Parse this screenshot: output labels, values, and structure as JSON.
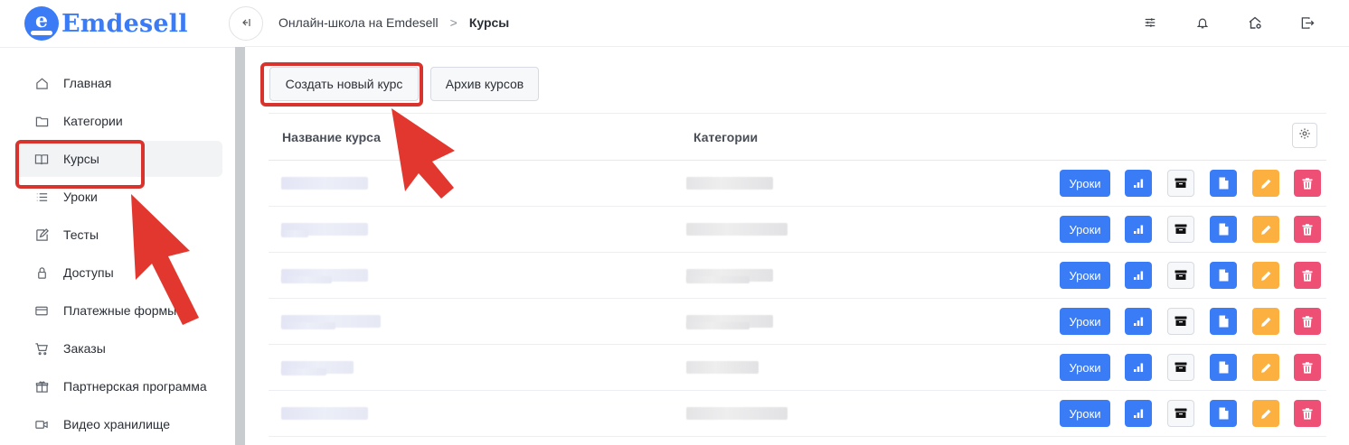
{
  "app": {
    "logo_text": "Emdesell",
    "logo_letter": "e",
    "brand_color": "#3b7cf6"
  },
  "sidebar": {
    "items": [
      {
        "label": "Главная",
        "icon": "home-icon",
        "active": false
      },
      {
        "label": "Категории",
        "icon": "folder-icon",
        "active": false
      },
      {
        "label": "Курсы",
        "icon": "book-icon",
        "active": true
      },
      {
        "label": "Уроки",
        "icon": "list-icon",
        "active": false
      },
      {
        "label": "Тесты",
        "icon": "edit-icon",
        "active": false
      },
      {
        "label": "Доступы",
        "icon": "lock-icon",
        "active": false
      },
      {
        "label": "Платежные формы",
        "icon": "credit-card-icon",
        "active": false
      },
      {
        "label": "Заказы",
        "icon": "cart-icon",
        "active": false
      },
      {
        "label": "Партнерская программа",
        "icon": "gift-icon",
        "active": false
      },
      {
        "label": "Видео хранилище",
        "icon": "video-icon",
        "active": false
      }
    ]
  },
  "header": {
    "collapse_icon": "collapse-sidebar-icon",
    "breadcrumb": {
      "parent": "Онлайн-школа на Emdesell",
      "separator": ">",
      "current": "Курсы"
    },
    "icons": [
      "sliders-icon",
      "bell-icon",
      "home-settings-icon",
      "logout-icon"
    ]
  },
  "toolbar": {
    "create_label": "Создать новый курс",
    "archive_label": "Архив курсов"
  },
  "table": {
    "columns": {
      "name": "Название курса",
      "category": "Категории"
    },
    "settings_icon": "gear-icon",
    "row_count": 6,
    "actions": {
      "lessons_label": "Уроки",
      "icons": [
        "stats-icon",
        "archive-icon",
        "document-icon",
        "pencil-icon",
        "trash-icon"
      ]
    }
  },
  "colors": {
    "primary": "#3a7bf6",
    "warning": "#fbb040",
    "danger": "#ee4f75",
    "annotation": "#d9332d"
  }
}
